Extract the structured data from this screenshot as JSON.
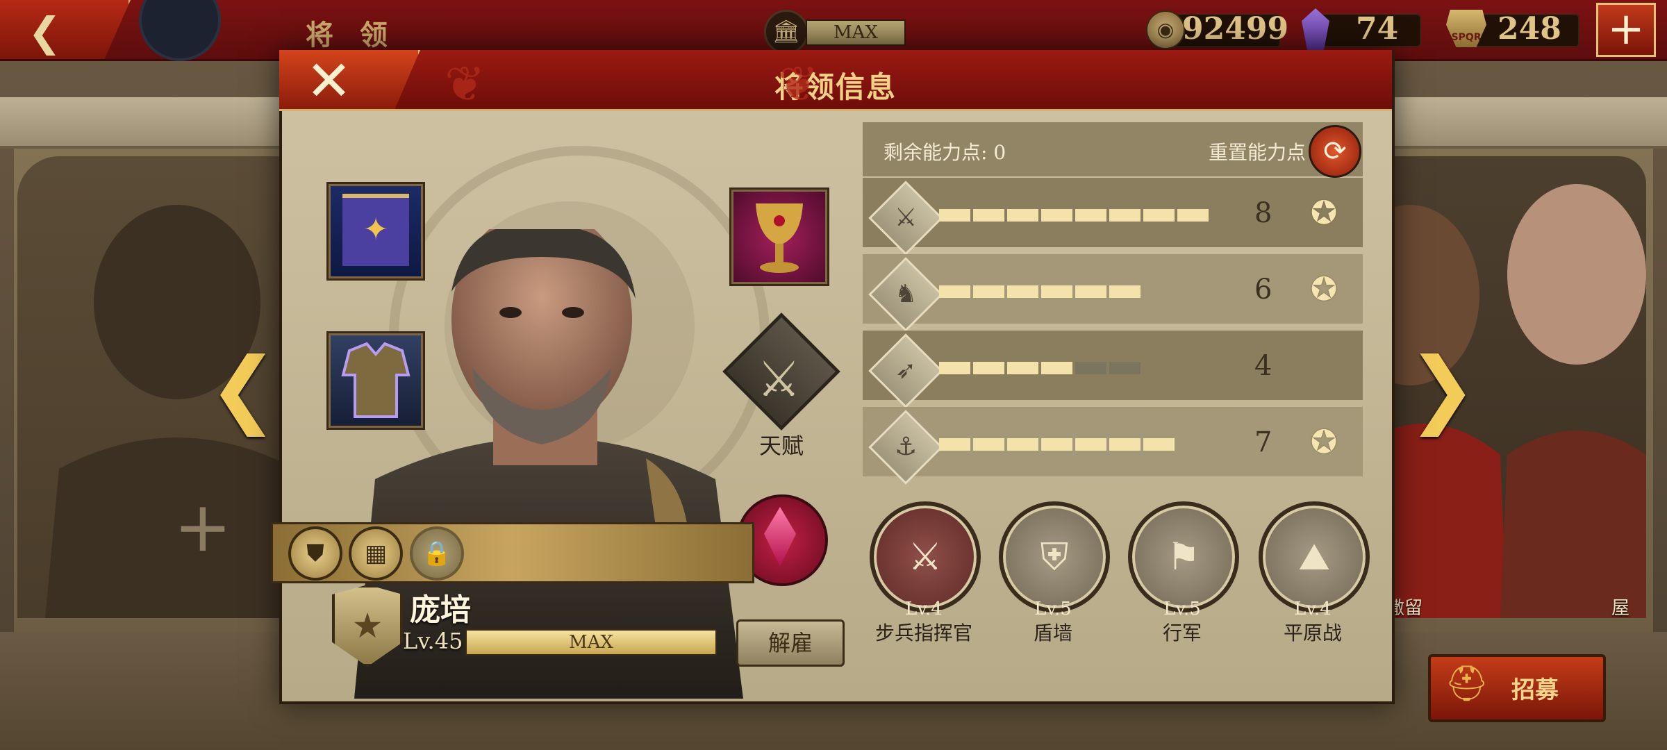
{
  "topbar": {
    "title": "将 领",
    "building_status": "MAX",
    "coins": "92499",
    "gems": "74",
    "tokens": "248",
    "token_icon_text": "SPQR",
    "add_label": "+"
  },
  "modal": {
    "title": "将领信息",
    "close_label": "✕"
  },
  "equipment": {
    "talent_label": "天赋"
  },
  "general": {
    "name": "庞培",
    "level": "Lv.45",
    "xp_status": "MAX",
    "xp_fill": 1.0,
    "dismiss_label": "解雇"
  },
  "stats": {
    "points_label": "剩余能力点: 0",
    "reset_label": "重置能力点",
    "rows": [
      {
        "icon": "sword-icon",
        "glyph": "⚔",
        "value": "8",
        "filled": 8,
        "total": 8,
        "badge": true
      },
      {
        "icon": "horse-icon",
        "glyph": "♞",
        "value": "6",
        "filled": 6,
        "total": 6,
        "badge": true
      },
      {
        "icon": "bow-icon",
        "glyph": "➶",
        "value": "4",
        "filled": 4,
        "total": 6,
        "badge": false
      },
      {
        "icon": "anchor-icon",
        "glyph": "⚓",
        "value": "7",
        "filled": 7,
        "total": 7,
        "badge": true
      }
    ]
  },
  "skills": [
    {
      "level": "Lv.4",
      "name": "步兵指挥官",
      "glyph": "⚔"
    },
    {
      "level": "Lv.5",
      "name": "盾墙",
      "glyph": "⛨"
    },
    {
      "level": "Lv.5",
      "name": "行军",
      "glyph": "⚑"
    },
    {
      "level": "Lv.4",
      "name": "平原战",
      "glyph": "⛰"
    }
  ],
  "side": {
    "right_name_1": "朔撒留",
    "right_name_2": "屋大维"
  },
  "recruit": {
    "label": "招募"
  },
  "colors": {
    "accent_gold": "#f3cb58",
    "header_red": "#7c1212",
    "bar_on": "#f3e3aa",
    "bar_off": "#7b745f"
  }
}
